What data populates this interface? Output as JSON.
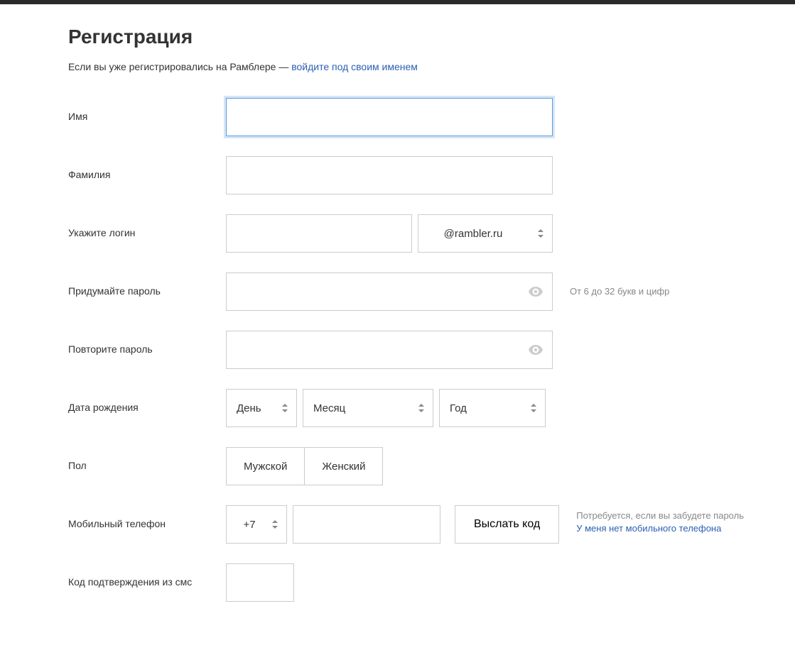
{
  "title": "Регистрация",
  "subtitle_prefix": "Если вы уже регистрировались на Рамблере — ",
  "subtitle_link": "войдите под своим именем",
  "labels": {
    "first_name": "Имя",
    "last_name": "Фамилия",
    "login": "Укажите логин",
    "password": "Придумайте пароль",
    "password_repeat": "Повторите пароль",
    "dob": "Дата рождения",
    "gender": "Пол",
    "phone": "Мобильный телефон",
    "sms_code": "Код подтверждения из смс"
  },
  "domain": "@rambler.ru",
  "dob": {
    "day": "День",
    "month": "Месяц",
    "year": "Год"
  },
  "gender": {
    "male": "Мужской",
    "female": "Женский"
  },
  "phone": {
    "code": "+7",
    "send_button": "Выслать код"
  },
  "hints": {
    "password": "От 6 до 32 букв и цифр",
    "phone_required": "Потребуется, если вы забудете пароль",
    "no_phone_link": "У меня нет мобильного телефона"
  }
}
